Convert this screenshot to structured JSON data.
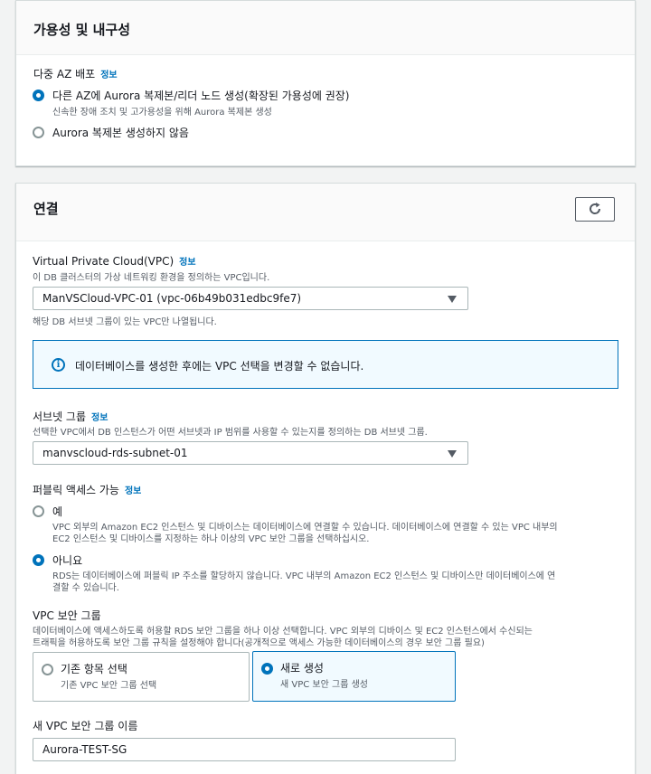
{
  "availability": {
    "title": "가용성 및 내구성",
    "multi_az": {
      "label": "다중 AZ 배포",
      "info": "정보",
      "options": [
        {
          "label": "다른 AZ에 Aurora 복제본/리더 노드 생성(확장된 가용성에 권장)",
          "description": "신속한 장애 조치 및 고가용성을 위해 Aurora 복제본 생성",
          "checked": true
        },
        {
          "label": "Aurora 복제본 생성하지 않음",
          "description": "",
          "checked": false
        }
      ]
    }
  },
  "connectivity": {
    "title": "연결",
    "refresh_icon": "refresh-icon",
    "vpc": {
      "label": "Virtual Private Cloud(VPC)",
      "info": "정보",
      "description": "이 DB 클러스터의 가상 네트워킹 환경을 정의하는 VPC입니다.",
      "value": "ManVSCloud-VPC-01 (vpc-06b49b031edbc9fe7)",
      "hint": "해당 DB 서브넷 그룹이 있는 VPC만 나열됩니다."
    },
    "alert": {
      "icon": "info-icon",
      "text": "데이터베이스를 생성한 후에는 VPC 선택을 변경할 수 없습니다."
    },
    "subnet": {
      "label": "서브넷 그룹",
      "info": "정보",
      "description": "선택한 VPC에서 DB 인스턴스가 어떤 서브넷과 IP 범위를 사용할 수 있는지를 정의하는 DB 서브넷 그룹.",
      "value": "manvscloud-rds-subnet-01"
    },
    "public_access": {
      "label": "퍼블릭 액세스 가능",
      "info": "정보",
      "options": [
        {
          "label": "예",
          "desc_line1": "VPC 외부의 Amazon EC2 인스턴스 및 디바이스는 데이터베이스에 연결할 수 있습니다. 데이터베이스에 연결할 수 있는 VPC 내부의",
          "desc_line2": "EC2 인스턴스 및 디바이스를 지정하는 하나 이상의 VPC 보안 그룹을 선택하십시오.",
          "checked": false
        },
        {
          "label": "아니요",
          "desc_line1": "RDS는 데이터베이스에 퍼블릭 IP 주소를 할당하지 않습니다. VPC 내부의 Amazon EC2 인스턴스 및 디바이스만 데이터베이스에 연",
          "desc_line2": "결할 수 있습니다.",
          "checked": true
        }
      ]
    },
    "security_group": {
      "label": "VPC 보안 그룹",
      "desc_line1": "데이터베이스에 액세스하도록 허용할 RDS 보안 그룹을 하나 이상 선택합니다. VPC 외부의 디바이스 및 EC2 인스턴스에서 수신되는",
      "desc_line2": "트래픽을 허용하도록 보안 그룹 규칙을 설정해야 합니다(공개적으로 액세스 가능한 데이터베이스의 경우 보안 그룹 필요)",
      "tiles": [
        {
          "label": "기존 항목 선택",
          "description": "기존 VPC 보안 그룹 선택",
          "checked": false
        },
        {
          "label": "새로 생성",
          "description": "새 VPC 보안 그룹 생성",
          "checked": true
        }
      ]
    },
    "new_sg_name": {
      "label": "새 VPC 보안 그룹 이름",
      "value": "Aurora-TEST-SG"
    }
  },
  "colors": {
    "accent": "#0073bb",
    "border": "#aab7b8",
    "background": "#f2f3f3"
  }
}
